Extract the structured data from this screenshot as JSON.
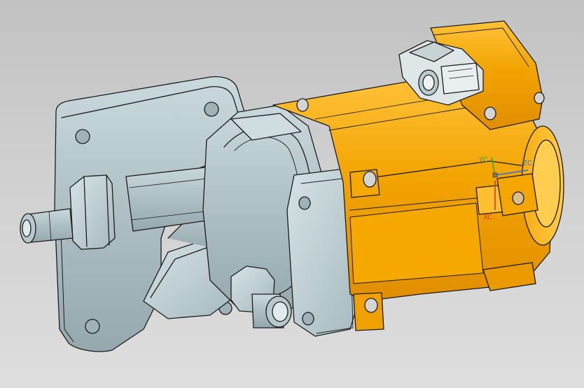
{
  "viewport": {
    "background_top": "#c2c2c2",
    "background_bottom": "#dedede"
  },
  "model": {
    "housing_color": "#f2a400",
    "housing_highlight": "#ffc23a",
    "flange_color": "#b3c6cb",
    "flange_shadow": "#8ea3a9",
    "edge_color": "#1c1c1c"
  },
  "triad": {
    "x_label": "XC",
    "y_label": "YC",
    "z_label": "ZC",
    "x_color": "#d23a3a",
    "y_color": "#2fa84a",
    "z_color": "#2f6fd6"
  }
}
